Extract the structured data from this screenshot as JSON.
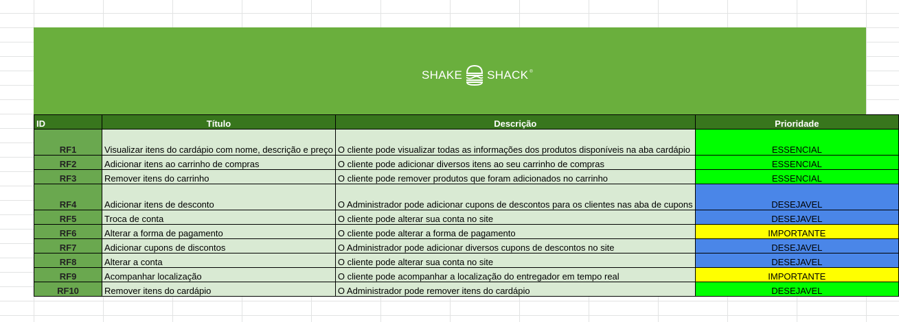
{
  "brand": {
    "name_left": "SHAKE",
    "name_right": "SHACK",
    "trademark": "®",
    "logo_icon": "burger-icon"
  },
  "colors": {
    "banner": "#6aaf3d",
    "header": "#38761d",
    "id_cell": "#6aa84f",
    "light_cell": "#d9ead3",
    "essencial": "#00ff00",
    "desejavel": "#4a86e8",
    "importante": "#ffff00"
  },
  "table": {
    "headers": {
      "id": "ID",
      "titulo": "Título",
      "descricao": "Descrição",
      "prioridade": "Prioridade"
    },
    "rows": [
      {
        "id": "RF1",
        "titulo": "Visualizar itens do cardápio com nome, descrição e preço",
        "descricao": "O cliente pode visualizar todas as informações dos produtos disponíveis na aba cardápio",
        "prioridade": "ESSENCIAL"
      },
      {
        "id": "RF2",
        "titulo": "Adicionar itens ao carrinho de compras",
        "descricao": "O cliente pode adicionar diversos itens ao seu carrinho de compras",
        "prioridade": "ESSENCIAL"
      },
      {
        "id": "RF3",
        "titulo": "Remover itens do carrinho",
        "descricao": "O cliente pode remover produtos que foram adicionados no carrinho",
        "prioridade": "ESSENCIAL"
      },
      {
        "id": "RF4",
        "titulo": "Adicionar itens de desconto",
        "descricao": "O Administrador pode adicionar cupons de descontos para os clientes nas aba de cupons",
        "prioridade": "DESEJAVEL"
      },
      {
        "id": "RF5",
        "titulo": "Troca de conta",
        "descricao": "O cliente pode alterar sua conta no site",
        "prioridade": "DESEJAVEL"
      },
      {
        "id": "RF6",
        "titulo": "Alterar a forma de pagamento",
        "descricao": "O cliente pode alterar a forma de pagamento",
        "prioridade": "IMPORTANTE"
      },
      {
        "id": "RF7",
        "titulo": "Adicionar cupons de discontos",
        "descricao": "O Administrador pode adicionar diversos cupons de descontos no site",
        "prioridade": "DESEJAVEL"
      },
      {
        "id": "RF8",
        "titulo": "Alterar a conta",
        "descricao": "O cliente pode alterar sua conta no site",
        "prioridade": "DESEJAVEL"
      },
      {
        "id": "RF9",
        "titulo": "Acompanhar localização",
        "descricao": "O cliente pode acompanhar a localização do entregador em tempo real",
        "prioridade": "IMPORTANTE"
      },
      {
        "id": "RF10",
        "titulo": "Remover itens do cardápio",
        "descricao": "O Administrador pode remover itens do cardápio",
        "prioridade": "DESEJAVEL"
      }
    ]
  }
}
